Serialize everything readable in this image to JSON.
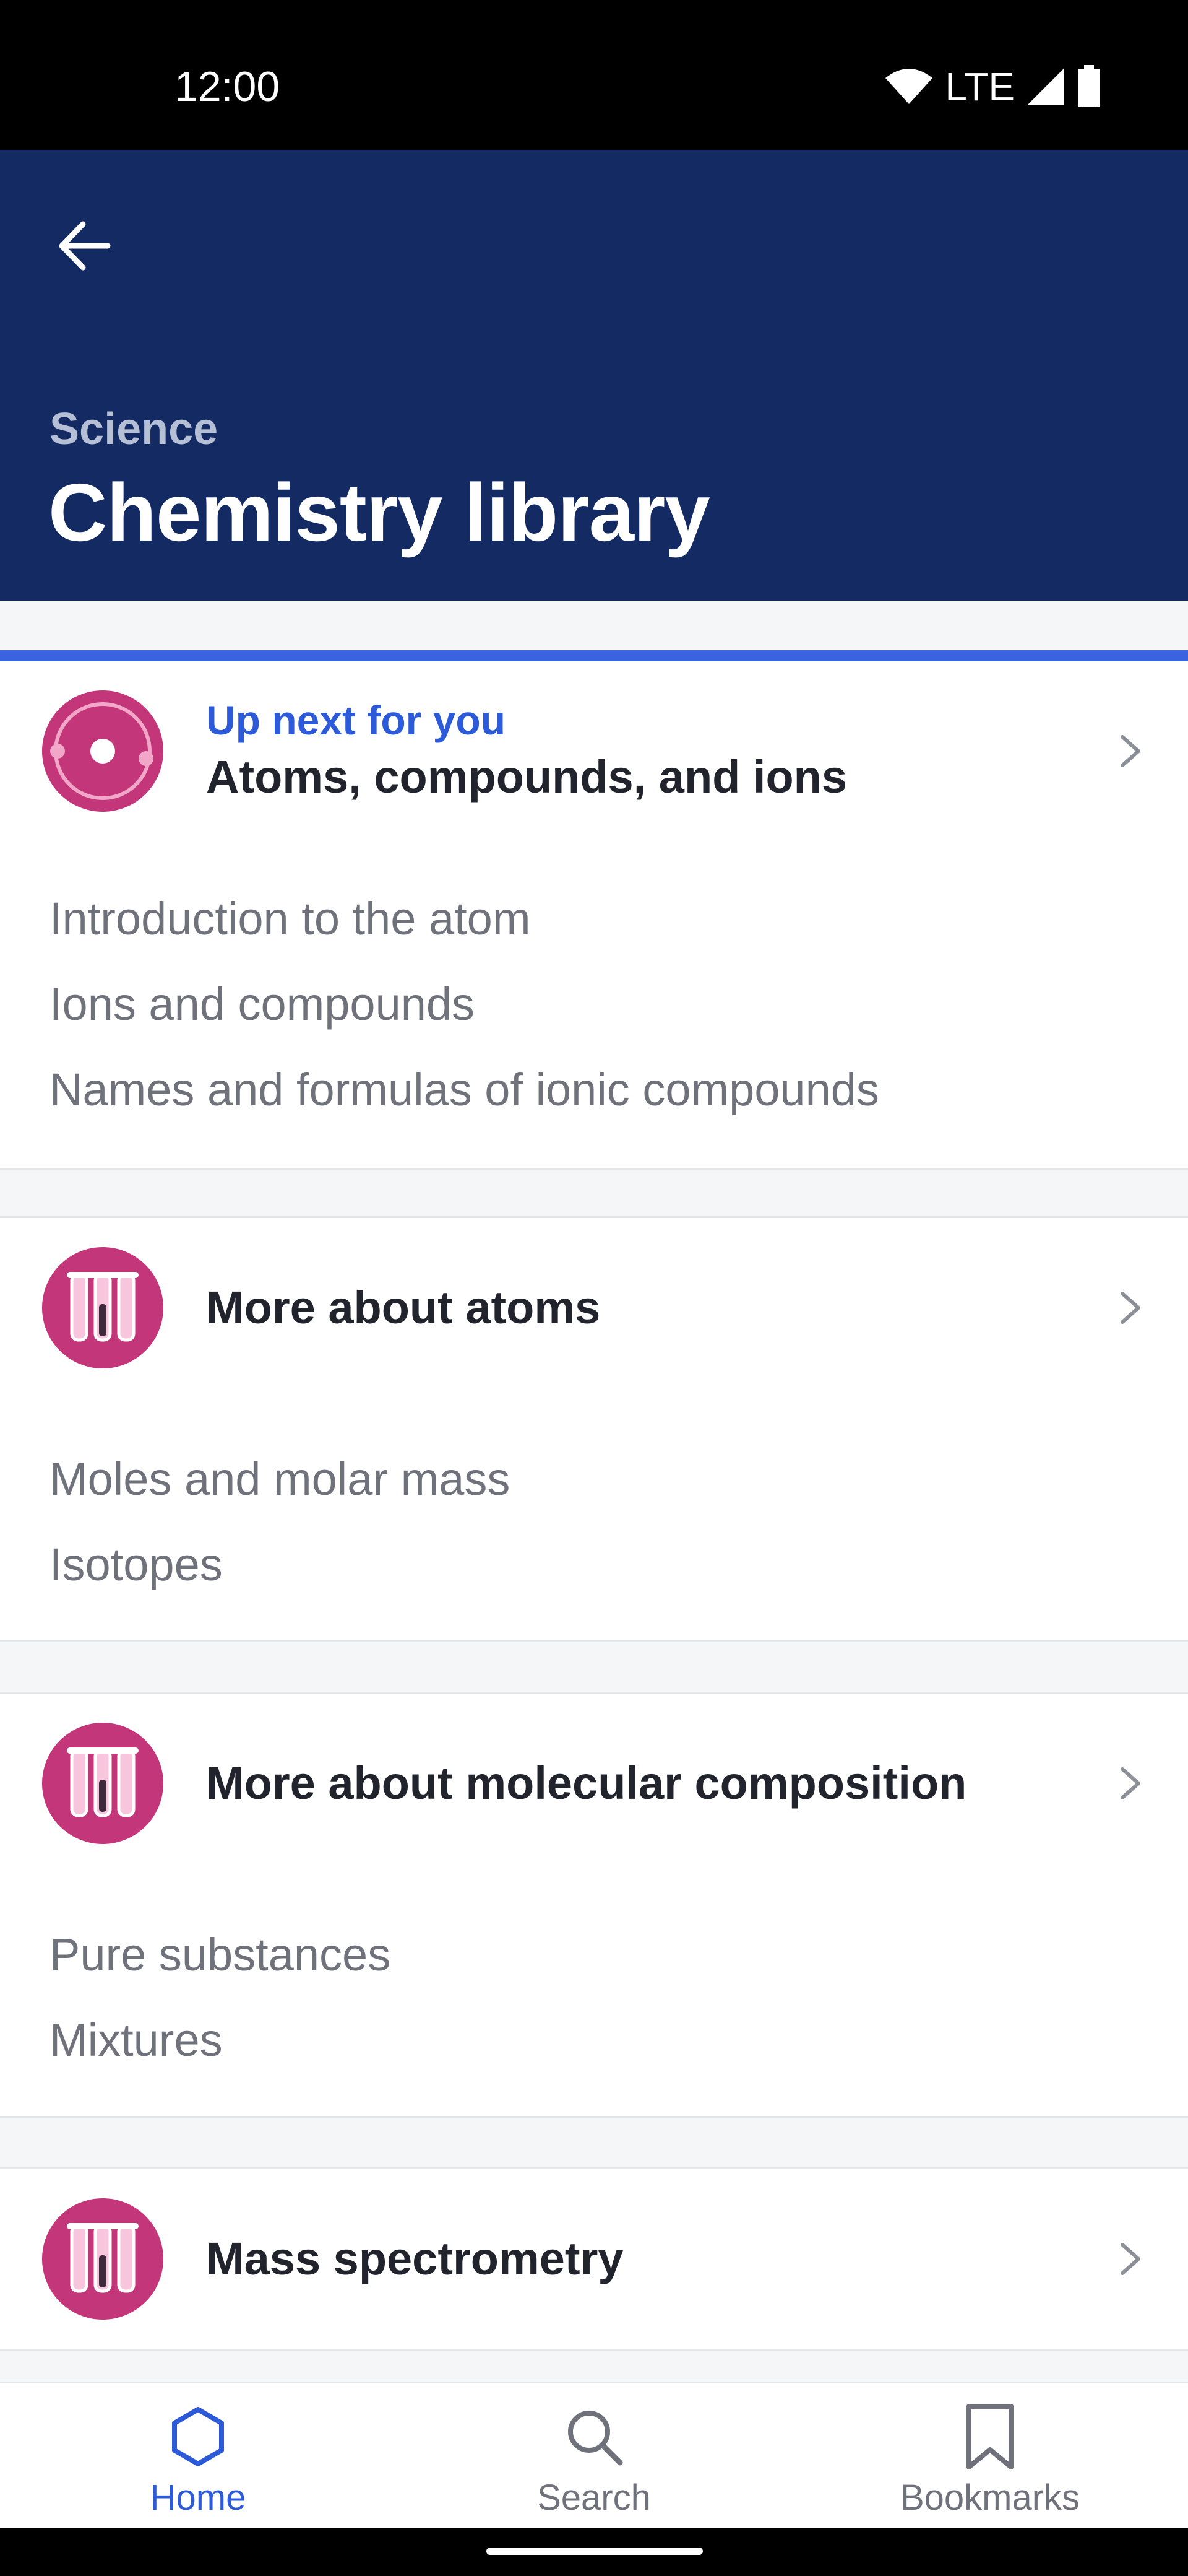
{
  "status_bar": {
    "time": "12:00",
    "network": "LTE"
  },
  "header": {
    "subject": "Science",
    "title": "Chemistry library"
  },
  "units": [
    {
      "kicker": "Up next for you",
      "title": "Atoms, compounds, and ions",
      "icon": "atom-icon",
      "lessons": [
        "Introduction to the atom",
        "Ions and compounds",
        "Names and formulas of ionic compounds"
      ]
    },
    {
      "title": "More about atoms",
      "icon": "test-tubes-icon",
      "lessons": [
        "Moles and molar mass",
        "Isotopes"
      ]
    },
    {
      "title": "More about molecular composition",
      "icon": "test-tubes-icon",
      "lessons": [
        "Pure substances",
        "Mixtures"
      ]
    },
    {
      "title": "Mass spectrometry",
      "icon": "test-tubes-icon",
      "lessons": []
    }
  ],
  "bottom_nav": [
    {
      "label": "Home",
      "icon": "home-hexagon-icon",
      "active": true
    },
    {
      "label": "Search",
      "icon": "search-icon",
      "active": false
    },
    {
      "label": "Bookmarks",
      "icon": "bookmark-icon",
      "active": false
    }
  ],
  "colors": {
    "header_bg": "#132a63",
    "accent": "#2c5ad8",
    "badge": "#c4367a"
  }
}
